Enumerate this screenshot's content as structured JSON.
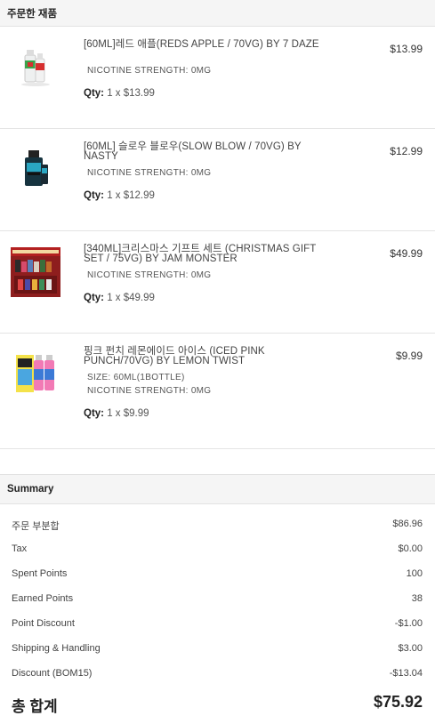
{
  "ordered_items_header": "주문한 재품",
  "items": [
    {
      "title": "[60ML]레드 애플(REDS APPLE / 70VG) BY 7 DAZE",
      "options": [
        "NICOTINE STRENGTH:  0MG"
      ],
      "qty_label": "Qty:",
      "qty_value": "1 x $13.99",
      "price": "$13.99",
      "thumb": "reds-apple-bottle-image"
    },
    {
      "title": "[60ML] 슬로우 블로우(SLOW BLOW / 70VG) BY NASTY",
      "options": [
        "NICOTINE STRENGTH:  0MG"
      ],
      "qty_label": "Qty:",
      "qty_value": "1 x $12.99",
      "price": "$12.99",
      "thumb": "slow-blow-bottle-image"
    },
    {
      "title": "[340ML]크리스마스 기프트 세트 (CHRISTMAS GIFT SET / 75VG) BY JAM MONSTER",
      "options": [
        "NICOTINE STRENGTH:  0MG"
      ],
      "qty_label": "Qty:",
      "qty_value": "1 x $49.99",
      "price": "$49.99",
      "thumb": "christmas-gift-set-image"
    },
    {
      "title": "핑크 펀치 레몬에이드 아이스 (ICED PINK PUNCH/70VG) BY LEMON TWIST",
      "options": [
        "SIZE:  60ML(1BOTTLE)",
        "NICOTINE STRENGTH:  0MG"
      ],
      "qty_label": "Qty:",
      "qty_value": "1 x $9.99",
      "price": "$9.99",
      "thumb": "pink-punch-bottles-image"
    }
  ],
  "summary": {
    "title": "Summary",
    "rows": [
      {
        "label": "주문 부분합",
        "value": "$86.96"
      },
      {
        "label": "Tax",
        "value": "$0.00"
      },
      {
        "label": "Spent Points",
        "value": "100"
      },
      {
        "label": "Earned Points",
        "value": "38"
      },
      {
        "label": "Point Discount",
        "value": "-$1.00"
      },
      {
        "label": "Shipping & Handling",
        "value": "$3.00"
      },
      {
        "label": "Discount (BOM15)",
        "value": "-$13.04"
      }
    ],
    "total_label": "총 합계",
    "total_value": "$75.92"
  }
}
